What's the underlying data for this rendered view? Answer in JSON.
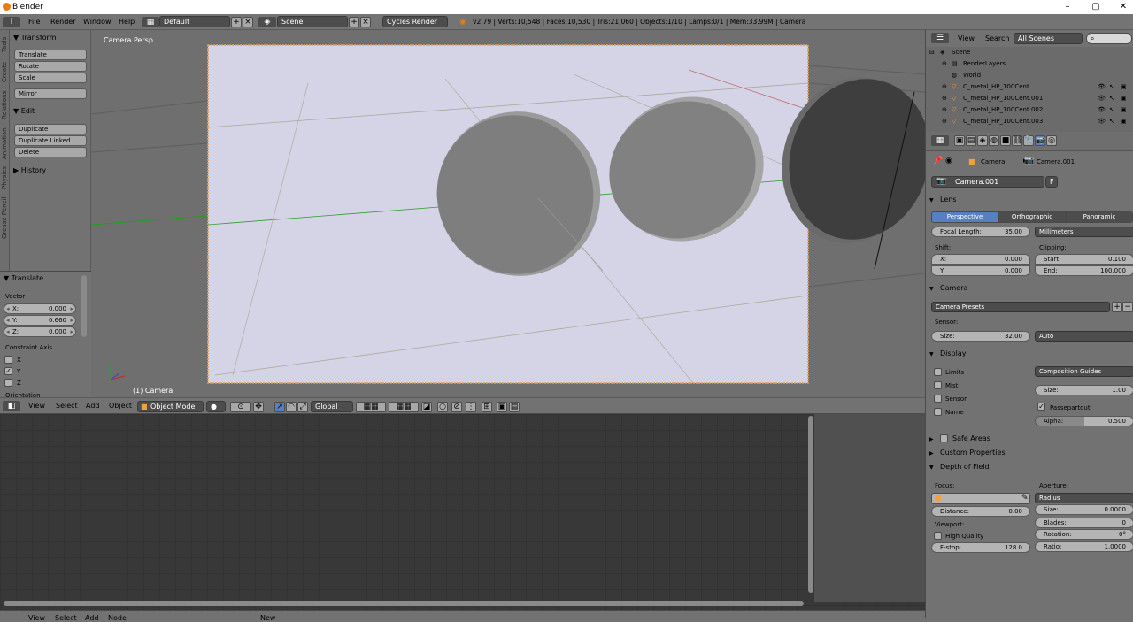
{
  "window": {
    "title": "Blender"
  },
  "menubar": {
    "items": [
      "File",
      "Render",
      "Window",
      "Help"
    ],
    "screen_layout": "Default",
    "scene_name": "Scene",
    "render_engine": "Cycles Render",
    "stats": "v2.79 | Verts:10,548 | Faces:10,530 | Tris:21,060 | Objects:1/10 | Lamps:0/1 | Mem:33.99M | Camera"
  },
  "sidebar_tabs": [
    "Tools",
    "Create",
    "Relations",
    "Animation",
    "Physics",
    "Grease Pencil"
  ],
  "toolshelf": {
    "transform": {
      "header": "Transform",
      "buttons": [
        "Translate",
        "Rotate",
        "Scale",
        "Mirror"
      ]
    },
    "edit": {
      "header": "Edit",
      "buttons": [
        "Duplicate",
        "Duplicate Linked",
        "Delete"
      ]
    },
    "history": {
      "header": "History"
    }
  },
  "operator_panel": {
    "header": "Translate",
    "vector_label": "Vector",
    "vector": [
      {
        "label": "X:",
        "value": "0.000"
      },
      {
        "label": "Y:",
        "value": "0.660"
      },
      {
        "label": "Z:",
        "value": "0.000"
      }
    ],
    "constraint_label": "Constraint Axis",
    "constraint_axes": [
      {
        "label": "X",
        "checked": false
      },
      {
        "label": "Y",
        "checked": true
      },
      {
        "label": "Z",
        "checked": false
      }
    ],
    "orientation_label": "Orientation"
  },
  "viewport": {
    "view_label": "Camera Persp",
    "object_label": "(1) Camera"
  },
  "viewport_header": {
    "menus": [
      "View",
      "Select",
      "Add",
      "Object"
    ],
    "mode": "Object Mode",
    "orientation": "Global"
  },
  "node_header": {
    "menus": [
      "View",
      "Select",
      "Add",
      "Node"
    ],
    "new_button": "New"
  },
  "outliner": {
    "menus": [
      "View",
      "Search"
    ],
    "scenes_dropdown": "All Scenes",
    "tree": [
      {
        "label": "Scene",
        "level": 0
      },
      {
        "label": "RenderLayers",
        "level": 1
      },
      {
        "label": "World",
        "level": 1
      },
      {
        "label": "C_metal_HP_100Cent",
        "level": 1
      },
      {
        "label": "C_metal_HP_100Cent.001",
        "level": 1
      },
      {
        "label": "C_metal_HP_100Cent.002",
        "level": 1
      },
      {
        "label": "C_metal_HP_100Cent.003",
        "level": 1
      }
    ]
  },
  "properties": {
    "breadcrumb_object": "Camera",
    "breadcrumb_data": "Camera.001",
    "datablock_name": "Camera.001",
    "fake_user": "F",
    "lens": {
      "header": "Lens",
      "types": [
        "Perspective",
        "Orthographic",
        "Panoramic"
      ],
      "active_type": "Perspective",
      "focal_label": "Focal Length:",
      "focal_value": "35.00",
      "unit": "Millimeters",
      "shift_label": "Shift:",
      "shift_x": "0.000",
      "shift_y": "0.000",
      "clipping_label": "Clipping:",
      "clip_start": "0.100",
      "clip_end": "100.000",
      "x_label": "X:",
      "y_label": "Y:",
      "start_label": "Start:",
      "end_label": "End:"
    },
    "camera": {
      "header": "Camera",
      "presets": "Camera Presets",
      "sensor_label": "Sensor:",
      "size_label": "Size:",
      "size_value": "32.00",
      "fit": "Auto"
    },
    "display": {
      "header": "Display",
      "checks": [
        {
          "label": "Limits",
          "checked": false
        },
        {
          "label": "Mist",
          "checked": false
        },
        {
          "label": "Sensor",
          "checked": false
        },
        {
          "label": "Name",
          "checked": false
        }
      ],
      "composition": "Composition Guides",
      "size_label": "Size:",
      "size_value": "1.00",
      "passepartout_label": "Passepartout",
      "passepartout_checked": true,
      "alpha_label": "Alpha:",
      "alpha_value": "0.500"
    },
    "safe_areas": {
      "header": "Safe Areas"
    },
    "custom_props": {
      "header": "Custom Properties"
    },
    "dof": {
      "header": "Depth of Field",
      "focus_label": "Focus:",
      "distance_label": "Distance:",
      "distance_value": "0.00",
      "viewport_label": "Viewport:",
      "high_quality_label": "High Quality",
      "fstop_label": "F-stop:",
      "fstop_value": "128.0",
      "aperture_label": "Aperture:",
      "aperture_type": "Radius",
      "size_label": "Size:",
      "size_value": "0.0000",
      "blades_label": "Blades:",
      "blades_value": "0",
      "rotation_label": "Rotation:",
      "rotation_value": "0°",
      "ratio_label": "Ratio:",
      "ratio_value": "1.0000"
    }
  },
  "colors": {
    "accent": "#5680c2",
    "passepartout_frame": "#e0a060",
    "camera_bg": "#d4d4e6"
  }
}
